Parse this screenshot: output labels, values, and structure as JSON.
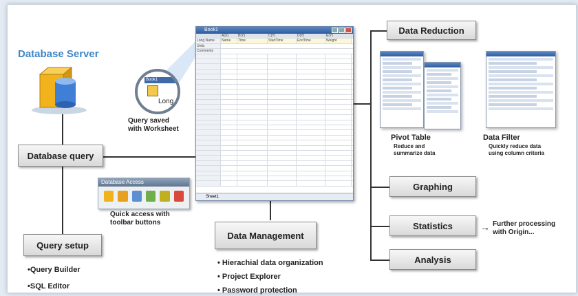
{
  "database_server_title": "Database Server",
  "boxes": {
    "database_query": "Database query",
    "query_setup": "Query setup",
    "data_management": "Data Management",
    "data_reduction": "Data Reduction",
    "graphing": "Graphing",
    "statistics": "Statistics",
    "analysis": "Analysis"
  },
  "query_saved": [
    "Query saved",
    "with Worksheet"
  ],
  "toolbar": {
    "title": "Database Access",
    "caption": [
      "Quick access with",
      "toolbar buttons"
    ]
  },
  "magnifier": {
    "window_title": "Book1",
    "label": "Long"
  },
  "query_setup_items": [
    "•Query Builder",
    "•SQL Editor"
  ],
  "data_management_items": [
    "• Hierachial data organization",
    "• Project Explorer",
    "• Password protection"
  ],
  "pivot_table": {
    "title": "Pivot Table",
    "desc": [
      "Reduce and",
      "summarize data"
    ]
  },
  "data_filter": {
    "title": "Data Filter",
    "desc": [
      "Quickly reduce data",
      "using column criteria"
    ]
  },
  "further_processing": [
    "Further processing",
    "with Origin..."
  ],
  "worksheet": {
    "title": "Book1",
    "headers": [
      "",
      "A(X)",
      "B(Y)",
      "C(Y)",
      "D(Y)",
      "E(Y)"
    ],
    "row_labels": [
      "Long Name",
      "Units",
      "Comments"
    ],
    "long_name_cells": [
      "Name",
      "Time",
      "StartTime",
      "EndTime",
      "Weight"
    ],
    "sheet_tab": "Sheet1"
  }
}
